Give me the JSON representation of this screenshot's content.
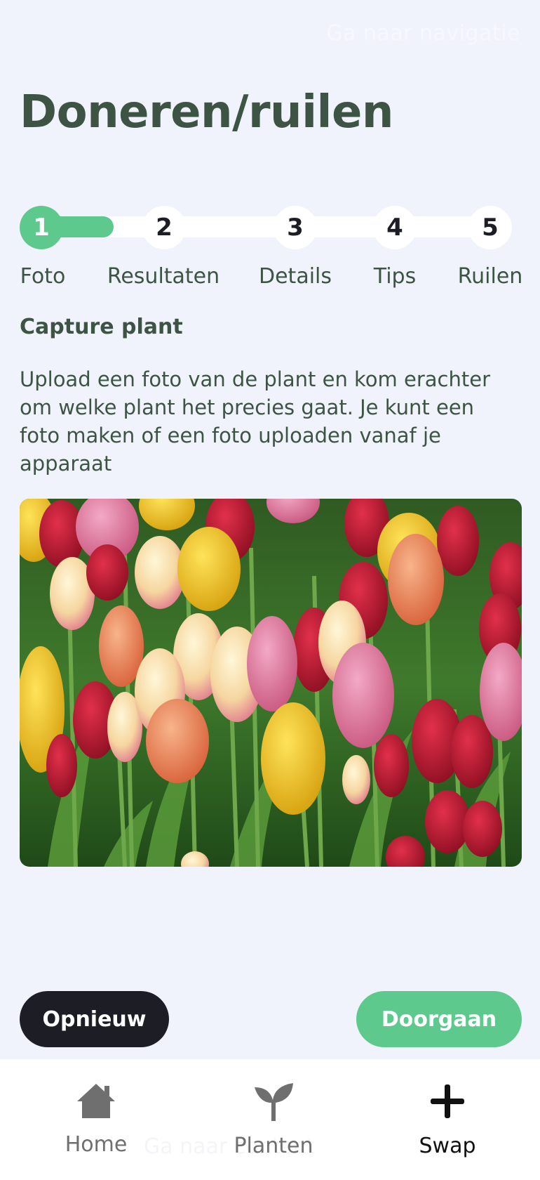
{
  "header": {
    "title": "Doneren/ruilen",
    "ghost_text": "Ga naar navigatie"
  },
  "stepper": {
    "progress": 0.2,
    "steps": [
      {
        "number": "1",
        "label": "Foto",
        "active": true
      },
      {
        "number": "2",
        "label": "Resultaten",
        "active": false
      },
      {
        "number": "3",
        "label": "Details",
        "active": false
      },
      {
        "number": "4",
        "label": "Tips",
        "active": false
      },
      {
        "number": "5",
        "label": "Ruilen",
        "active": false
      }
    ]
  },
  "content": {
    "section_title": "Capture plant",
    "description": "Upload een foto van de plant en kom erachter om welke plant het precies gaat. Je kunt een foto maken of een foto uploaden vanaf je apparaat",
    "photo_subject": "tulips"
  },
  "actions": {
    "retry_label": "Opnieuw",
    "continue_label": "Doorgaan"
  },
  "tabbar": {
    "ghost_text": "Ga naar content",
    "items": [
      {
        "label": "Home",
        "icon": "home-icon",
        "active": false
      },
      {
        "label": "Planten",
        "icon": "sprout-icon",
        "active": false
      },
      {
        "label": "Swap",
        "icon": "plus-icon",
        "active": true
      }
    ]
  },
  "colors": {
    "accent": "#5dc98d",
    "dark_button": "#1d1d26",
    "heading": "#3d5444",
    "background": "#f0f3fc"
  }
}
